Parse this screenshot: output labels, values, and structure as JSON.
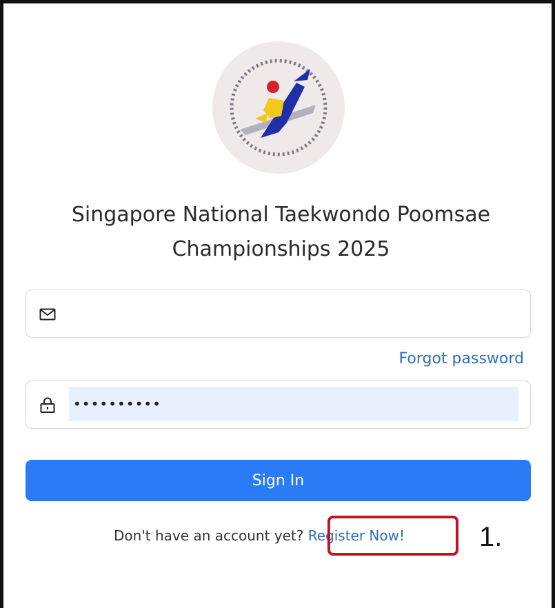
{
  "logo": {
    "icon": "taekwondo-association-logo",
    "colors": {
      "background": "#efe9ea",
      "blue": "#1e2fa8",
      "yellow": "#f2c81d",
      "red": "#d4222a"
    }
  },
  "title": {
    "line1": "Singapore National Taekwondo Poomsae",
    "line2": "Championships 2025"
  },
  "email_field": {
    "icon": "envelope-icon",
    "value": "",
    "placeholder": ""
  },
  "forgot_password_label": "Forgot password",
  "password_field": {
    "icon": "lock-icon",
    "value": "••••••••••"
  },
  "sign_in_label": "Sign In",
  "register": {
    "prompt": "Don't have an account yet?",
    "link_label": "Register Now!"
  },
  "annotation": {
    "step_label": "1.",
    "highlight_color": "#c0161f"
  },
  "colors": {
    "accent": "#2b7bf6",
    "link": "#2f6fbd"
  }
}
